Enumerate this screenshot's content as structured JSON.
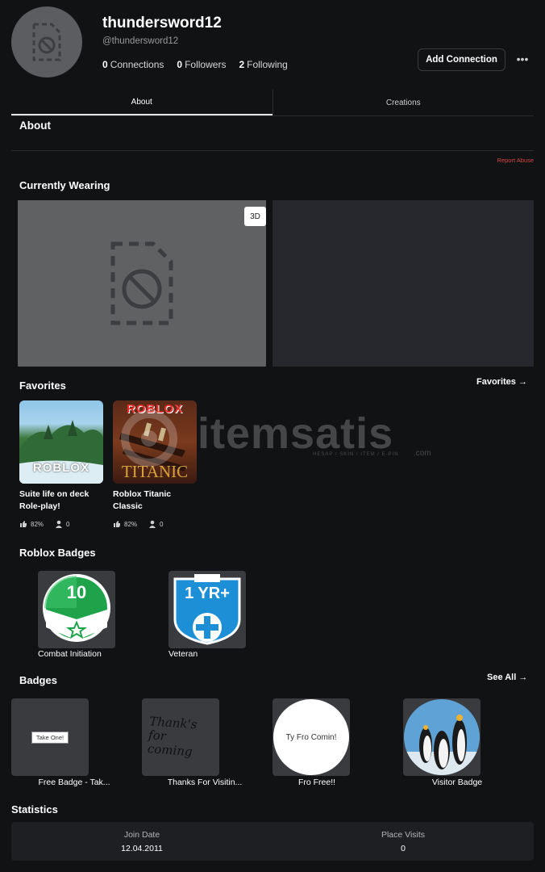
{
  "profile": {
    "display_name": "thundersword12",
    "handle": "@thundersword12",
    "connections_count": "0",
    "connections_label": "Connections",
    "followers_count": "0",
    "followers_label": "Followers",
    "following_count": "2",
    "following_label": "Following",
    "add_connection_label": "Add Connection",
    "more_label": "•••"
  },
  "tabs": [
    {
      "label": "About",
      "active": true
    },
    {
      "label": "Creations",
      "active": false
    }
  ],
  "about": {
    "title": "About",
    "report_abuse": "Report Abuse"
  },
  "wearing": {
    "title": "Currently Wearing",
    "toggle_3d_label": "3D"
  },
  "favorites": {
    "title": "Favorites",
    "link_label": "Favorites →",
    "items": [
      {
        "name": "Suite life on deck Role-play!",
        "rating": "82%",
        "players": "0",
        "thumb_text": "ROBLOX"
      },
      {
        "name": "Roblox Titanic Classic",
        "rating": "82%",
        "players": "0",
        "thumb_text_top": "ROBLOX",
        "thumb_text_bottom": "TITANIC"
      }
    ]
  },
  "watermark": {
    "text": "itemsatis",
    "subtext": "HESAP / SKIN / ITEM / E-PIN",
    "suffix": ".com"
  },
  "roblox_badges": {
    "title": "Roblox Badges",
    "items": [
      {
        "name": "Combat Initiation",
        "icon_text": "10",
        "color": "#1fa34a"
      },
      {
        "name": "Veteran",
        "icon_text": "1 YR+",
        "color": "#1c8fd6"
      }
    ]
  },
  "badges": {
    "title": "Badges",
    "link_label": "See All →",
    "items": [
      {
        "name": "Free Badge - Tak...",
        "image_text": "Take One!"
      },
      {
        "name": "Thanks For Visitin...",
        "image_text": "Thank's for coming"
      },
      {
        "name": "Fro Free!!",
        "image_text": "Ty Fro Comin!"
      },
      {
        "name": "Visitor Badge",
        "image_text": ""
      }
    ]
  },
  "statistics": {
    "title": "Statistics",
    "join_date_label": "Join Date",
    "join_date_value": "12.04.2011",
    "place_visits_label": "Place Visits",
    "place_visits_value": "0"
  }
}
